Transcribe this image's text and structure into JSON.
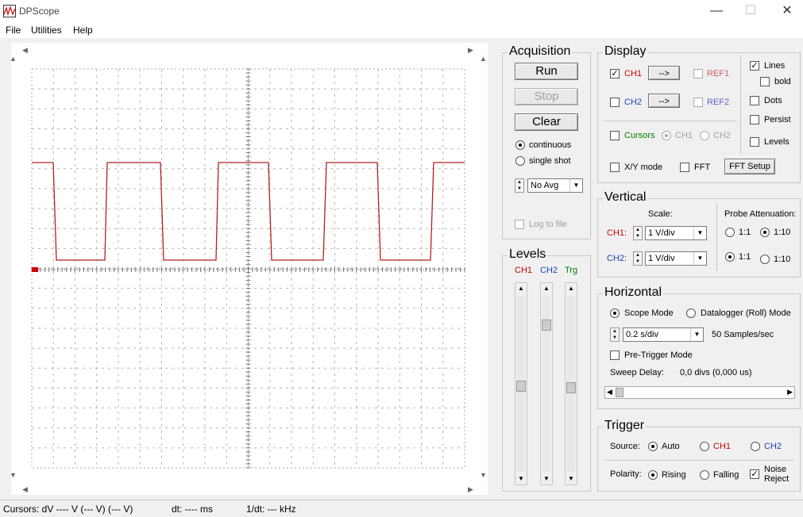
{
  "window": {
    "title": "DPScope",
    "minimize": "—",
    "maximize": "☐",
    "close": "✕"
  },
  "menu": {
    "file": "File",
    "utilities": "Utilities",
    "help": "Help"
  },
  "scope": {
    "trace_color": "#b22222",
    "levels_high": [
      1,
      1,
      1,
      1,
      1
    ],
    "marker_color": "#cc0000"
  },
  "acquisition": {
    "title": "Acquisition",
    "run": "Run",
    "stop": "Stop",
    "clear": "Clear",
    "continuous": "continuous",
    "single_shot": "single shot",
    "avg_value": "No Avg",
    "log_to_file": "Log to file"
  },
  "levels": {
    "title": "Levels",
    "ch1": "CH1",
    "ch2": "CH2",
    "trg": "Trg"
  },
  "display": {
    "title": "Display",
    "ch1": "CH1",
    "ch2": "CH2",
    "ref1": "REF1",
    "ref2": "REF2",
    "arrow_btn": "-->",
    "cursors": "Cursors",
    "cursor_ch1": "CH1",
    "cursor_ch2": "CH2",
    "lines": "Lines",
    "bold": "bold",
    "dots": "Dots",
    "persist": "Persist",
    "levels": "Levels",
    "xy_mode": "X/Y mode",
    "fft": "FFT",
    "fft_setup": "FFT Setup",
    "ch1_color": "#cc0000",
    "ch2_color": "#2040c0",
    "ref_color": "#d06060",
    "ref2_color": "#6060d0",
    "cursor_color": "#008000"
  },
  "vertical": {
    "title": "Vertical",
    "scale_label": "Scale:",
    "ch1_label": "CH1:",
    "ch1_scale": "1 V/div",
    "ch2_label": "CH2:",
    "ch2_scale": "1 V/div",
    "probe_label": "Probe Attenuation:",
    "p11": "1:1",
    "p110": "1:10"
  },
  "horizontal": {
    "title": "Horizontal",
    "scope_mode": "Scope Mode",
    "datalogger_mode": "Datalogger (Roll) Mode",
    "timebase": "0.2 s/div",
    "samples": "50 Samples/sec",
    "pretrigger": "Pre-Trigger Mode",
    "sweep_delay_label": "Sweep Delay:",
    "sweep_delay_value": "0,0 divs (0,000 us)"
  },
  "trigger": {
    "title": "Trigger",
    "source_label": "Source:",
    "auto": "Auto",
    "ch1": "CH1",
    "ch2": "CH2",
    "polarity_label": "Polarity:",
    "rising": "Rising",
    "falling": "Falling",
    "noise": "Noise",
    "reject": "Reject"
  },
  "status": {
    "cursors": "Cursors:  dV  ---- V   (--- V) (--- V)",
    "dt": "dt:  ---- ms",
    "inv_dt": "1/dt:  --- kHz"
  }
}
